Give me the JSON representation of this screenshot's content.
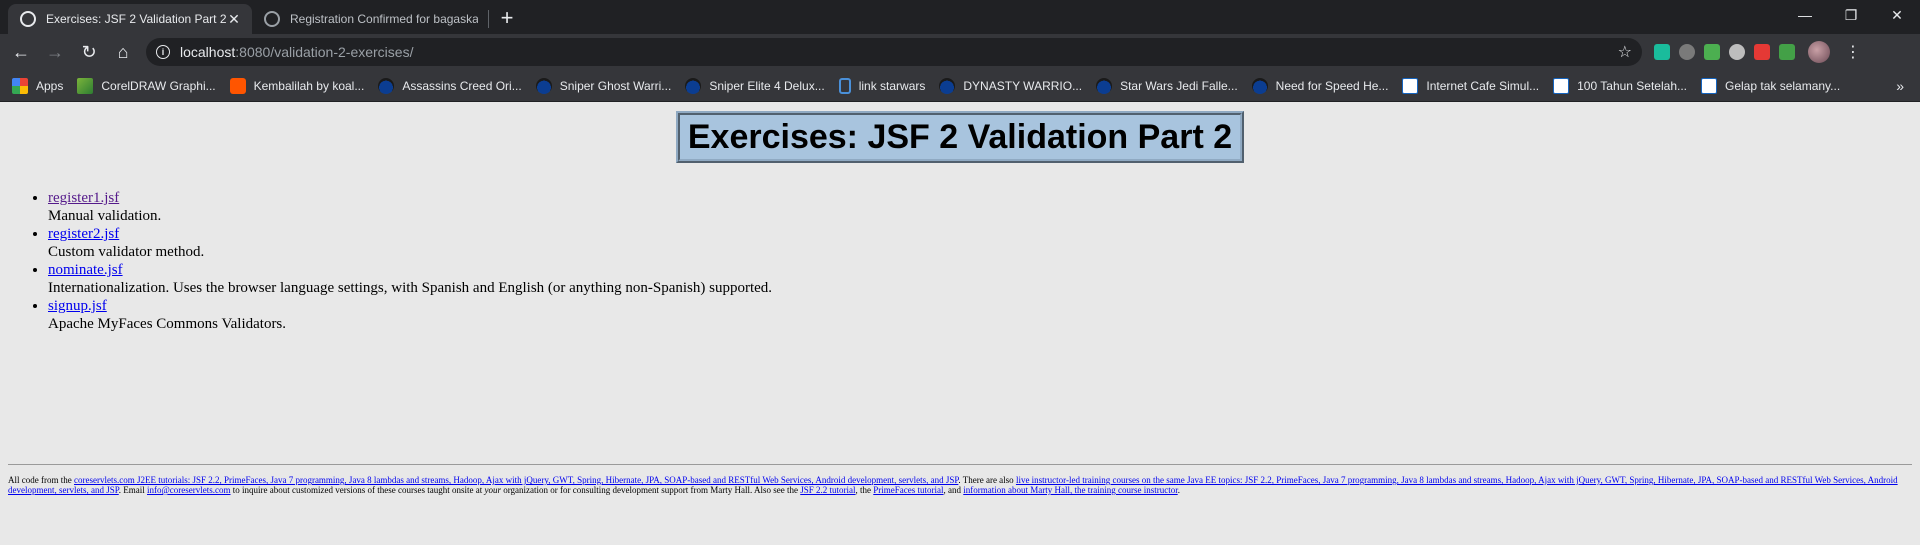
{
  "tabs": [
    {
      "title": "Exercises: JSF 2 Validation Part 2",
      "close": "✕"
    },
    {
      "title": "Registration Confirmed for bagaskarait",
      "close": "✕"
    }
  ],
  "new_tab": "+",
  "window_controls": {
    "minimize": "—",
    "restore": "❐",
    "close": "✕"
  },
  "toolbar": {
    "back": "←",
    "forward": "→",
    "reload": "↻",
    "home": "⌂",
    "info": "i",
    "url_host": "localhost",
    "url_rest": ":8080/validation-2-exercises/",
    "star": "☆",
    "menu": "⋮"
  },
  "bookmarks": [
    {
      "label": "Apps",
      "icon": "apps-icon"
    },
    {
      "label": "CorelDRAW Graphi...",
      "icon": "corel-icon"
    },
    {
      "label": "Kembalilah by koal...",
      "icon": "soundcloud-icon"
    },
    {
      "label": "Assassins Creed Ori...",
      "icon": "ninja-icon"
    },
    {
      "label": "Sniper Ghost Warri...",
      "icon": "ninja-icon"
    },
    {
      "label": "Sniper Elite 4 Delux...",
      "icon": "ninja-icon"
    },
    {
      "label": "link starwars",
      "icon": "starwars-icon"
    },
    {
      "label": "DYNASTY WARRIO...",
      "icon": "ninja-icon"
    },
    {
      "label": "Star Wars Jedi Falle...",
      "icon": "ninja-icon"
    },
    {
      "label": "Need for Speed He...",
      "icon": "ninja-icon"
    },
    {
      "label": "Internet Cafe Simul...",
      "icon": "k-icon"
    },
    {
      "label": "100 Tahun Setelah...",
      "icon": "k-icon"
    },
    {
      "label": "Gelap tak selamany...",
      "icon": "k-icon"
    }
  ],
  "bookmarks_more": "»",
  "page": {
    "title": "Exercises: JSF 2 Validation Part 2",
    "exercises": [
      {
        "link": "register1.jsf",
        "desc": "Manual validation."
      },
      {
        "link": "register2.jsf",
        "desc": "Custom validator method."
      },
      {
        "link": "nominate.jsf",
        "desc": "Internationalization. Uses the browser language settings, with Spanish and English (or anything non-Spanish) supported."
      },
      {
        "link": "signup.jsf",
        "desc": "Apache MyFaces Commons Validators."
      }
    ],
    "footer": {
      "t1": "All code from the ",
      "l1": "coreservlets.com J2EE tutorials: JSF 2.2, PrimeFaces, Java 7 programming, Java 8 lambdas and streams, Hadoop, Ajax with jQuery, GWT, Spring, Hibernate, JPA, SOAP-based and RESTful Web Services, Android development, servlets, and JSP",
      "t2": ". There are also ",
      "l2": "live instructor-led training courses on the same Java EE topics: JSF 2.2, PrimeFaces, Java 7 programming, Java 8 lambdas and streams, Hadoop, Ajax with jQuery, GWT, Spring, Hibernate, JPA, SOAP-based and RESTful Web Services, Android development, servlets, and JSP",
      "t3": ". Email ",
      "l3": "info@coreservlets.com",
      "t4": " to inquire about customized versions of these courses taught onsite at ",
      "em": "your",
      "t5": " organization or for consulting development support from Marty Hall. Also see the ",
      "l4": "JSF 2.2 tutorial",
      "t6": ", the ",
      "l5": "PrimeFaces tutorial",
      "t7": ", and ",
      "l6": "information about Marty Hall, the training course instructor",
      "t8": "."
    }
  }
}
